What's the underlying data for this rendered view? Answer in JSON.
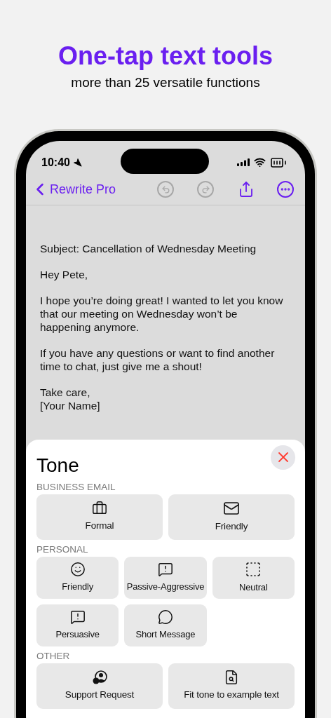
{
  "headline": "One-tap text tools",
  "subtitle": "more than 25 versatile functions",
  "status_bar": {
    "time": "10:40"
  },
  "nav": {
    "back_label": "Rewrite Pro",
    "undo_disabled": true,
    "redo_disabled": true
  },
  "document": {
    "paragraphs": [
      "Subject: Cancellation of Wednesday Meeting",
      "Hey Pete,",
      "I hope you’re doing great! I wanted to let you know that our meeting on Wednesday won’t be happening anymore.",
      "If you have any questions or want to find another time to chat, just give me a shout!",
      "Take care,\n[Your Name]"
    ]
  },
  "sheet": {
    "title": "Tone",
    "sections": [
      {
        "title": "BUSINESS EMAIL",
        "items": [
          "Formal",
          "Friendly"
        ]
      },
      {
        "title": "PERSONAL",
        "items": [
          "Friendly",
          "Passive-Aggressive",
          "Neutral",
          "Persuasive",
          "Short Message"
        ]
      },
      {
        "title": "OTHER",
        "items": [
          "Support Request",
          "Fit tone to example text"
        ]
      }
    ]
  }
}
